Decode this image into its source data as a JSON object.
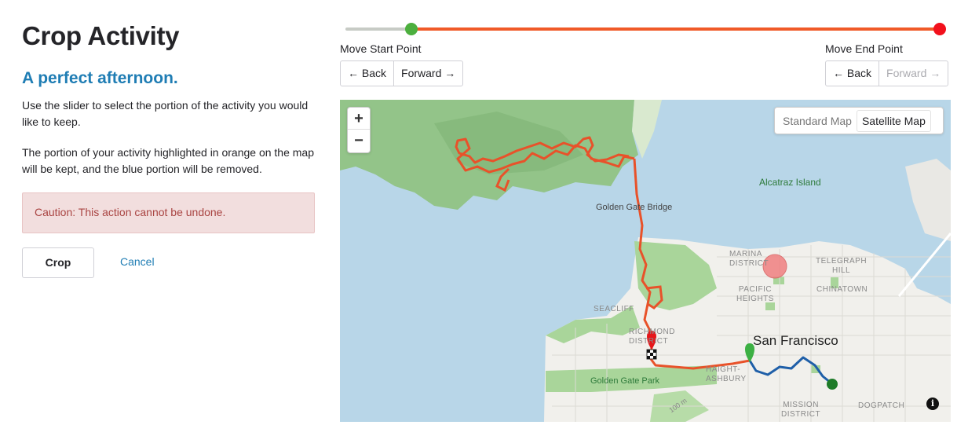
{
  "page": {
    "title": "Crop Activity",
    "activity_name": "A perfect afternoon.",
    "description_1": "Use the slider to select the portion of the activity you would like to keep.",
    "description_2": "The portion of your activity highlighted in orange on the map will be kept, and the blue portion will be removed.",
    "caution": "Caution: This action cannot be undone.",
    "crop_label": "Crop",
    "cancel_label": "Cancel"
  },
  "slider": {
    "start_fraction": 0.11,
    "end_fraction": 1.0,
    "colors": {
      "track": "#c7cbc5",
      "selected": "#f05a28",
      "start": "#4caf3e",
      "end": "#f2101c"
    }
  },
  "start_controls": {
    "label": "Move Start Point",
    "back": "← Back",
    "forward": "Forward →"
  },
  "end_controls": {
    "label": "Move End Point",
    "back": "← Back",
    "forward": "Forward →",
    "forward_disabled": true
  },
  "map": {
    "zoom_in": "+",
    "zoom_out": "−",
    "type_options": [
      "Standard Map",
      "Satellite Map"
    ],
    "selected_type": "Satellite Map",
    "labels": {
      "alcatraz": "Alcatraz Island",
      "golden_gate_bridge": "Golden Gate Bridge",
      "marina": "MARINA\nDISTRICT",
      "telegraph": "TELEGRAPH\nHILL",
      "chinatown": "CHINATOWN",
      "pacific_heights": "PACIFIC\nHEIGHTS",
      "seacliff": "SEACLIFF",
      "richmond": "RICHMOND\nDISTRICT",
      "san_francisco": "San Francisco",
      "haight": "HAIGHT-\nASHBURY",
      "golden_gate_park": "Golden Gate Park",
      "mission": "MISSION\nDISTRICT",
      "dogpatch": "DOGPATCH",
      "elevation": "100 m"
    },
    "info_icon": "i",
    "colors": {
      "kept_route": "#e8522a",
      "removed_route": "#1f5fa8",
      "water": "#b8d6e8",
      "land": "#f1f0ec",
      "park": "#a9d59a"
    }
  }
}
